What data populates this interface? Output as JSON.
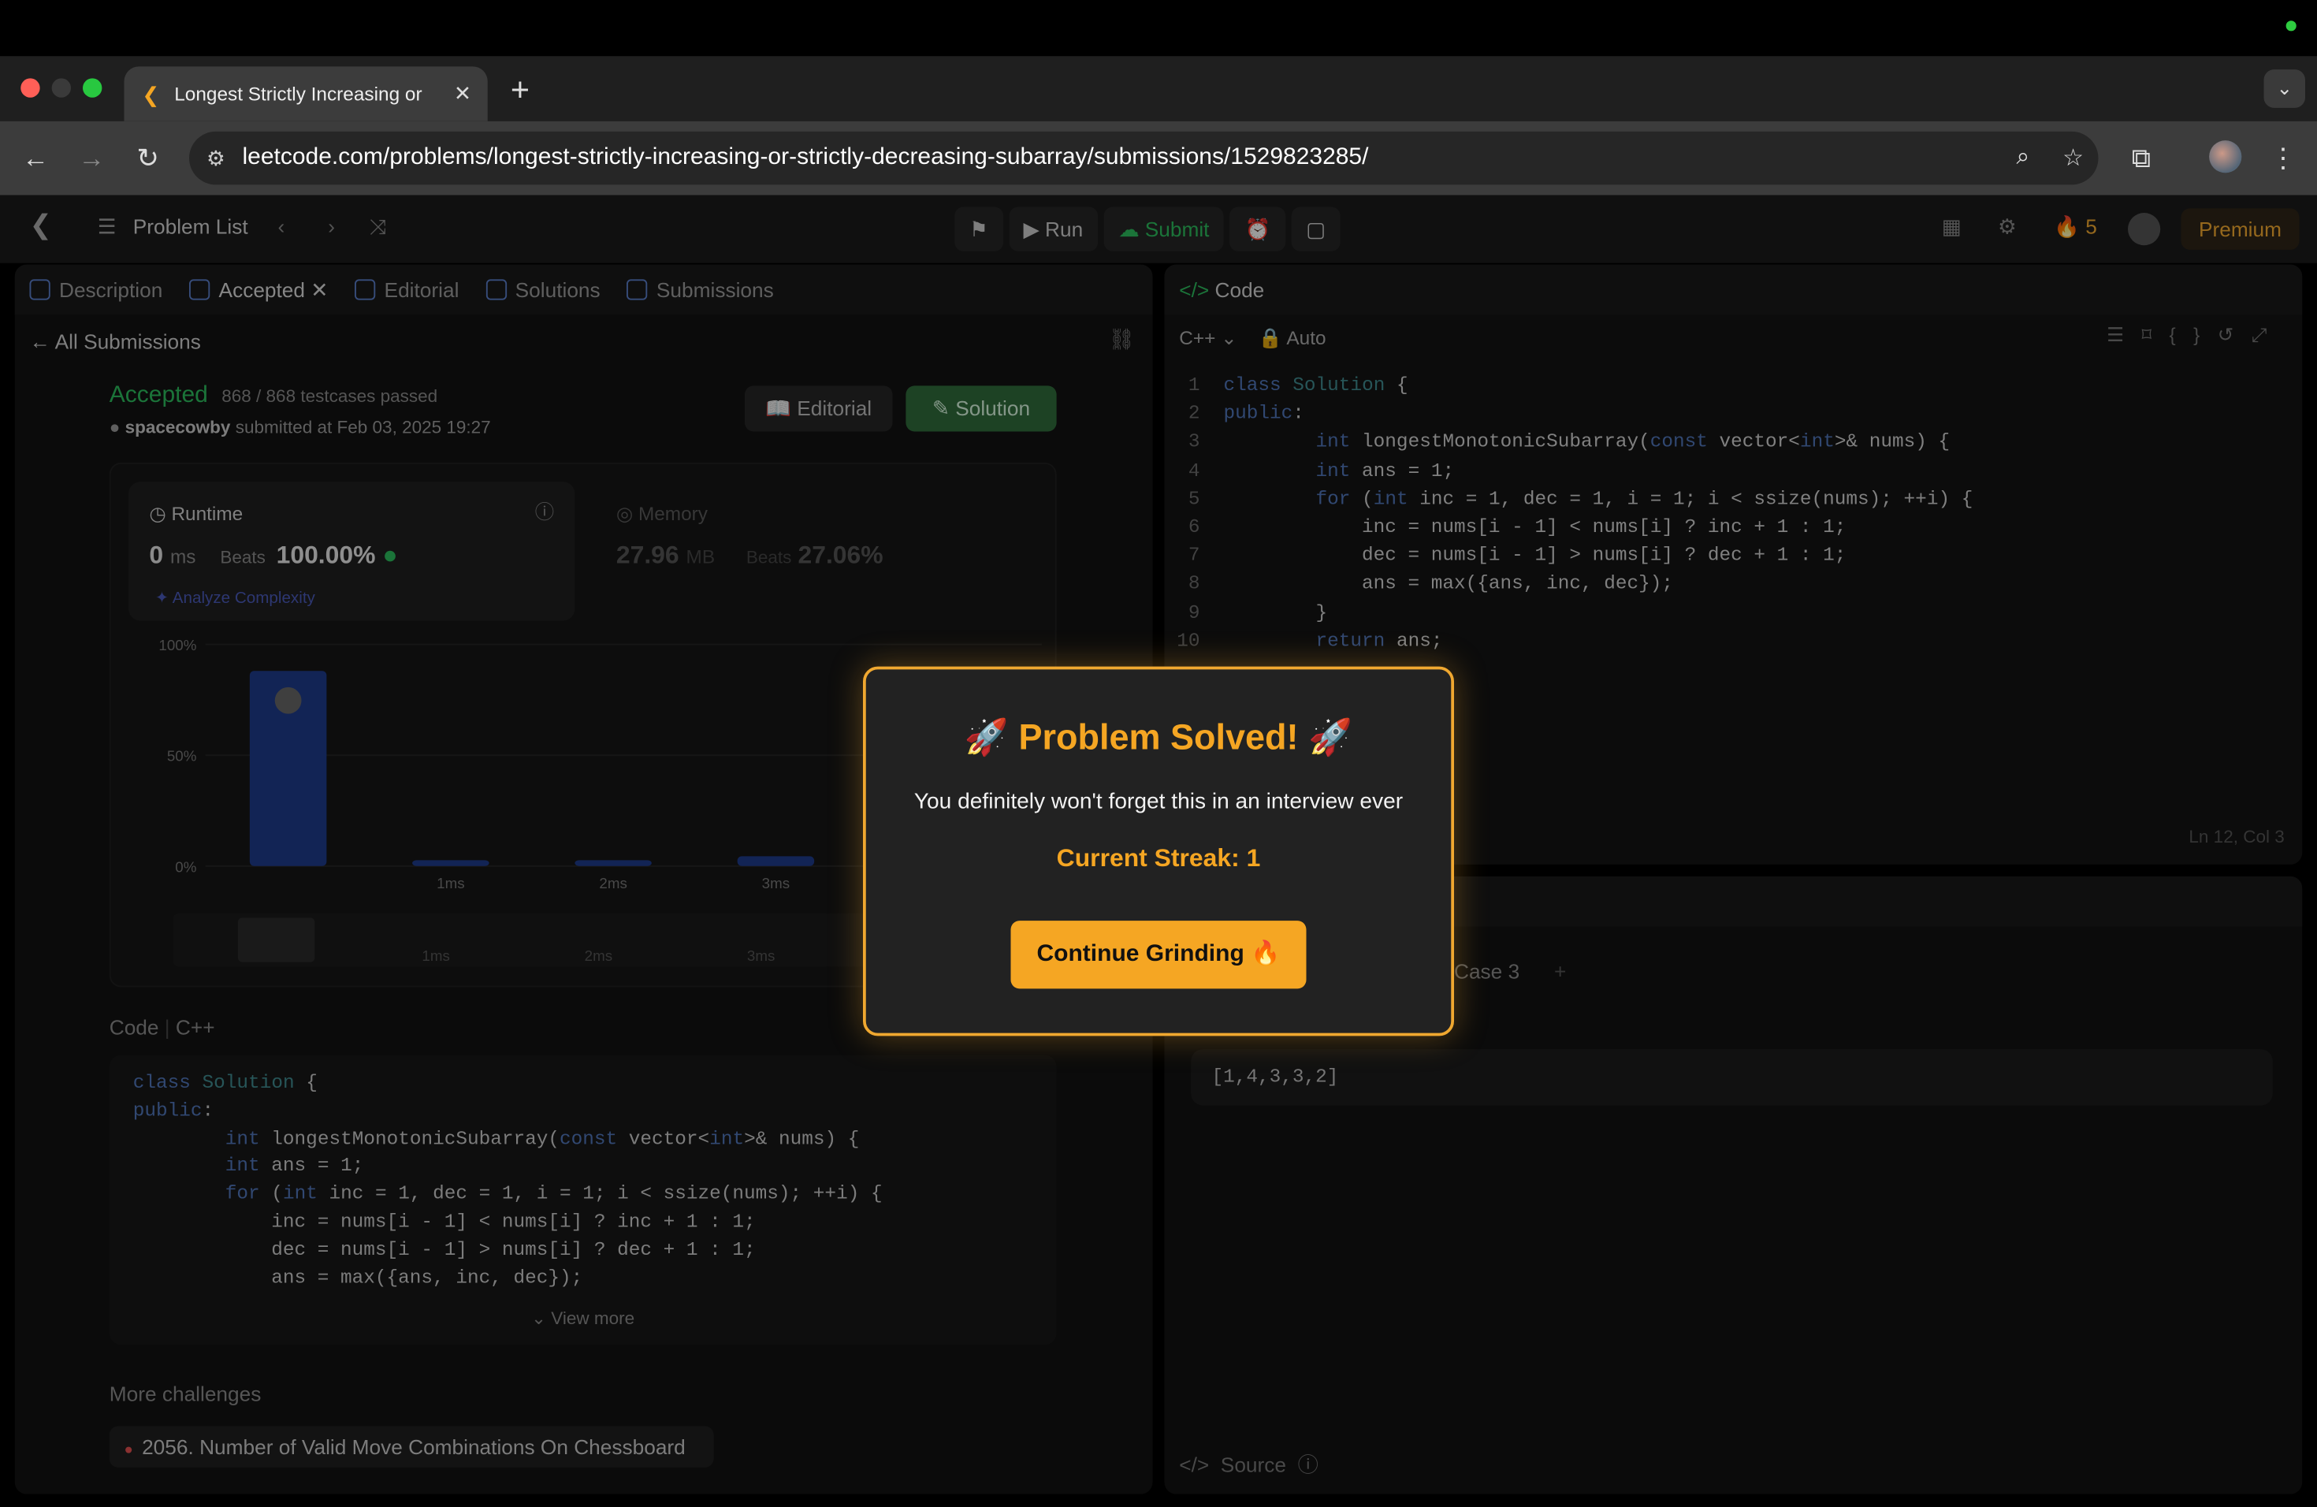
{
  "browser": {
    "tab_title": "Longest Strictly Increasing or",
    "url": "leetcode.com/problems/longest-strictly-increasing-or-strictly-decreasing-subarray/submissions/1529823285/"
  },
  "header": {
    "problem_list": "Problem List",
    "run": "Run",
    "submit": "Submit",
    "streak_count": "5",
    "premium": "Premium"
  },
  "left_tabs": [
    "Description",
    "Accepted",
    "Editorial",
    "Solutions",
    "Submissions"
  ],
  "submission": {
    "back": "All Submissions",
    "status": "Accepted",
    "testcases": "868 / 868 testcases passed",
    "user": "spacecowby",
    "submitted": "submitted at Feb 03, 2025 19:27",
    "editorial_btn": "Editorial",
    "solution_btn": "Solution",
    "runtime_label": "Runtime",
    "runtime_value": "0",
    "runtime_unit": "ms",
    "beats_label": "Beats",
    "runtime_beats": "100.00%",
    "analyze": "Analyze Complexity",
    "memory_label": "Memory",
    "memory_value": "27.96",
    "memory_unit": "MB",
    "memory_beats": "27.06%",
    "code_label": "Code",
    "code_lang": "C++",
    "view_more": "View more",
    "more_challenges": "More challenges",
    "challenge_1": "2056. Number of Valid Move Combinations On Chessboard"
  },
  "chart_data": {
    "type": "bar",
    "categories": [
      "0ms",
      "1ms",
      "2ms",
      "3ms"
    ],
    "x_tick_labels": [
      "1ms",
      "2ms",
      "3ms"
    ],
    "values": [
      100,
      3,
      3,
      5
    ],
    "y_ticks": [
      "100%",
      "50%",
      "0%"
    ],
    "ylim": [
      0,
      100
    ],
    "color": "#1e3a8a"
  },
  "editor": {
    "title": "Code",
    "lang": "C++",
    "mode": "Auto",
    "position": "Ln 12, Col 3",
    "case_tab": "Case 3",
    "input": "[1,4,3,3,2]",
    "source": "Source"
  },
  "modal": {
    "title": "🚀 Problem Solved! 🚀",
    "message": "You definitely won't forget this in an interview ever",
    "streak": "Current Streak: 1",
    "button": "Continue Grinding 🔥",
    "accent": "#f5a623"
  }
}
